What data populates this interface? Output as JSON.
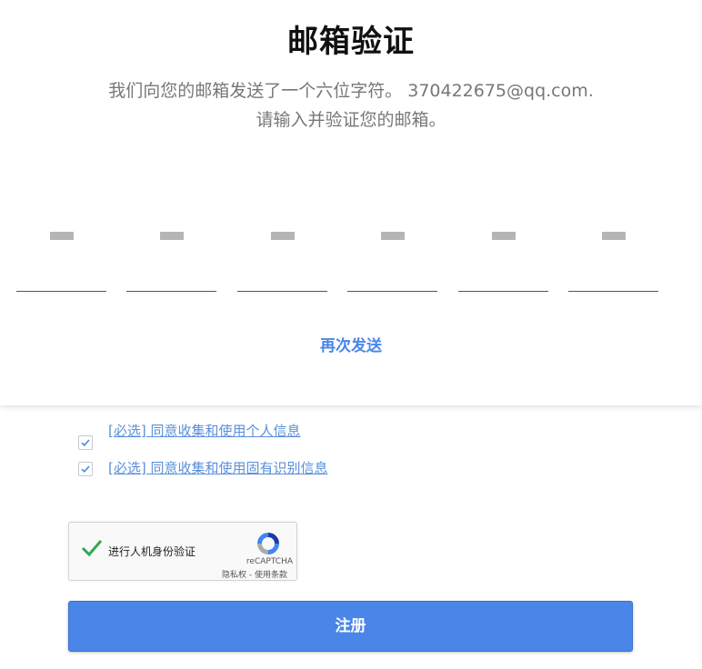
{
  "header": {
    "title": "邮箱验证",
    "description_line1": "我们向您的邮箱发送了一个六位字符。 370422675@qq.com.",
    "description_line2": "请输入并验证您的邮箱。"
  },
  "otp": {
    "digit_count": 6,
    "values": [
      "",
      "",
      "",
      "",
      "",
      ""
    ]
  },
  "resend_label": "再次发送",
  "agreements": [
    {
      "label": "[必选] 同意收集和使用个人信息",
      "checked": true
    },
    {
      "label": "[必选] 同意收集和使用固有识别信息",
      "checked": true
    }
  ],
  "captcha": {
    "label": "进行人机身份验证",
    "brand": "reCAPTCHA",
    "privacy": "隐私权",
    "separator": " - ",
    "terms": "使用条款",
    "verified": true,
    "icon": "recaptcha-logo-icon"
  },
  "register_label": "注册",
  "colors": {
    "accent": "#4a86e8",
    "link": "#5b8fd9",
    "check": "#34a853"
  }
}
